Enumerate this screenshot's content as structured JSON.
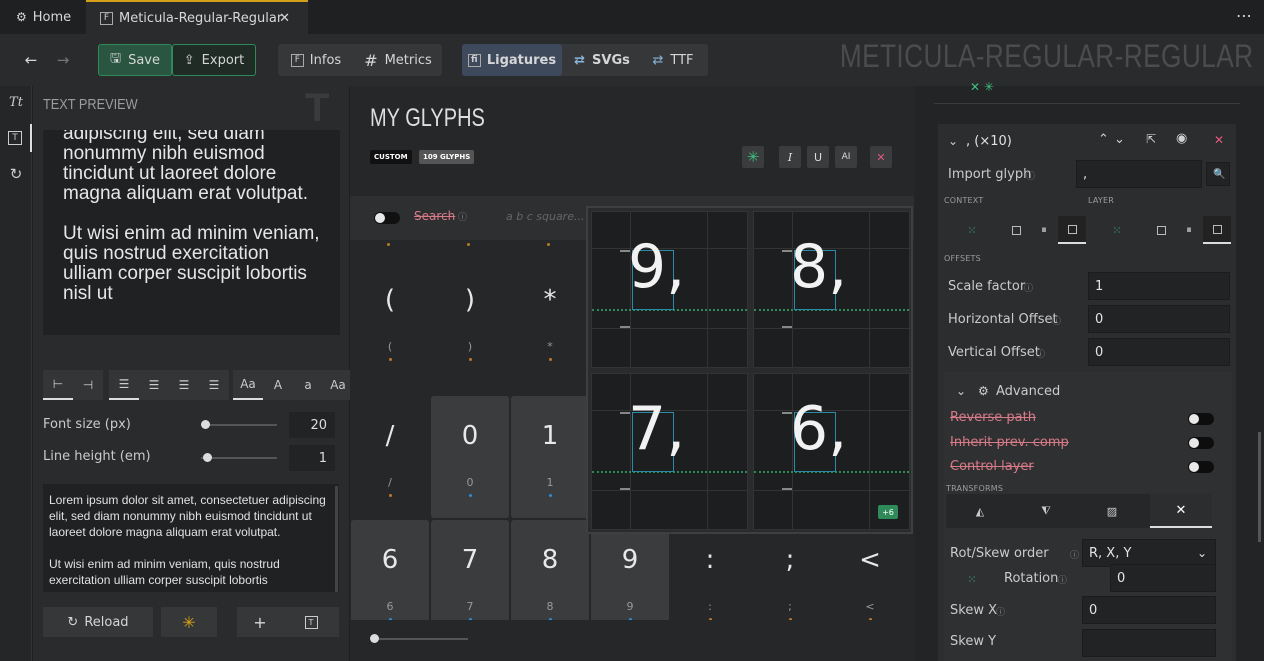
{
  "tabs": {
    "home": "Home",
    "font": "Meticula-Regular-Regular"
  },
  "toolbar": {
    "save": "Save",
    "export": "Export",
    "infos": "Infos",
    "metrics": "Metrics",
    "ligatures": "Ligatures",
    "svgs": "SVGs",
    "ttf": "TTF",
    "font_title": "METICULA-REGULAR-REGULAR"
  },
  "left": {
    "title": "TEXT PREVIEW",
    "preview_p1": "adipiscing elit, sed diam nonummy nibh euismod tincidunt ut laoreet dolore magna aliquam erat volutpat.",
    "preview_p2": "Ut wisi enim ad minim veniam, quis nostrud exercitation ulliam corper suscipit lobortis nisl ut",
    "font_size_label": "Font size (px)",
    "font_size": "20",
    "font_size_level": 0.0,
    "line_height_label": "Line height (em)",
    "line_height": "1",
    "line_height_level": 0.0,
    "text_p1": "Lorem ipsum dolor sit amet, consectetuer adipiscing elit, sed diam nonummy nibh euismod tincidunt ut laoreet dolore magna aliquam erat volutpat.",
    "text_p2": "Ut wisi enim ad minim veniam, quis nostrud exercitation ulliam corper suscipit lobortis",
    "reload": "Reload"
  },
  "center": {
    "title": "MY GLYPHS",
    "badge_custom": "CUSTOM",
    "badge_count": "109 GLYPHS",
    "search_label": "Search",
    "search_placeholder": "a b c square...",
    "rows": [
      [
        {
          "g": "(",
          "s": "("
        },
        {
          "g": ")",
          "s": ")"
        },
        {
          "g": "*",
          "s": "*"
        }
      ],
      [
        {
          "g": "/",
          "s": "/"
        },
        {
          "g": "0",
          "s": "0",
          "sel": true
        },
        {
          "g": "1",
          "s": "1",
          "sel": true
        }
      ],
      [
        {
          "g": "6",
          "s": "6",
          "sel": true
        },
        {
          "g": "7",
          "s": "7",
          "sel": true
        },
        {
          "g": "8",
          "s": "8",
          "sel": true
        },
        {
          "g": "9",
          "s": "9",
          "sel": true
        },
        {
          "g": ":",
          "s": ":"
        },
        {
          "g": ";",
          "s": ";"
        },
        {
          "g": "<",
          "s": "<"
        }
      ]
    ],
    "popup": {
      "glyphs": [
        "9,",
        "8,",
        "7,",
        "6,"
      ],
      "more": "+6"
    }
  },
  "right": {
    "glyph_header": ", (×10)",
    "import_label": "Import glyph",
    "import_value": ",",
    "context": "CONTEXT",
    "layer": "LAYER",
    "offsets": "OFFSETS",
    "scale_label": "Scale factor",
    "scale": "1",
    "h_label": "Horizontal Offset",
    "h": "0",
    "v_label": "Vertical Offset",
    "v": "0",
    "advanced": "Advanced",
    "reverse": "Reverse path",
    "inherit": "Inherit prev. comp",
    "control": "Control layer",
    "transforms": "TRANSFORMS",
    "rot_order_label": "Rot/Skew order",
    "rot_order": "R, X, Y",
    "rotation_label": "Rotation",
    "rotation": "0",
    "skewx_label": "Skew X",
    "skewx": "0",
    "skewy_label": "Skew Y"
  },
  "colors": {
    "accent": "#d4a017",
    "green": "#2f8a5a",
    "pink": "#e05a7a",
    "blue": "#2d8cd6"
  }
}
